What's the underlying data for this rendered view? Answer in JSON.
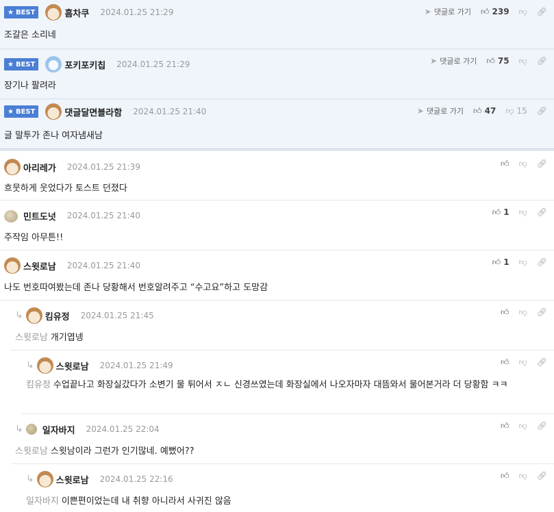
{
  "labels": {
    "best": "BEST",
    "goto": "댓글로 가기"
  },
  "comments": [
    {
      "best": true,
      "nick": "흠차쿠",
      "date": "2024.01.25 21:29",
      "text": "조갈은 소리네",
      "likes": "239"
    },
    {
      "best": true,
      "nick": "포키포키칩",
      "date": "2024.01.25 21:29",
      "text": "장기나 팔려라",
      "likes": "75"
    },
    {
      "best": true,
      "nick": "댓글달면블라함",
      "date": "2024.01.25 21:40",
      "text": "글 말투가 존나 여자냄새남",
      "likes": "47",
      "dislikes": "15"
    },
    {
      "nick": "아리레가",
      "date": "2024.01.25 21:39",
      "text": "흐뭇하게 웃었다가 토스트 던졌다"
    },
    {
      "nick": "민트도넛",
      "date": "2024.01.25 21:40",
      "text": "주작임 아무튼!!",
      "likes": "1"
    },
    {
      "nick": "스윗로남",
      "date": "2024.01.25 21:40",
      "text": "나도 번호따여봤는데 존나 당황해서 번호알려주고 “수고요”하고 도망감",
      "likes": "1"
    },
    {
      "nick": "킴유정",
      "date": "2024.01.25 21:45",
      "mention": "스윗로남",
      "text": "개기엽넹"
    },
    {
      "nick": "스윗로남",
      "date": "2024.01.25 21:49",
      "mention": "킴유정",
      "text": "수업끝나고 화장실갔다가 소변기 물 튀어서 ㅈㄴ 신경쓰였는데 화장실에서 나오자마자 대뜸와서 물어본거라 더 당황함 ㅋㅋ"
    },
    {
      "nick": "일자바지",
      "date": "2024.01.25 22:04",
      "mention": "스윗로남",
      "text": "스윗남이라 그런가 인기많네. 예뻤어??"
    },
    {
      "nick": "스윗로남",
      "date": "2024.01.25 22:16",
      "mention": "일자바지",
      "text": "이쁜편이었는데 내 취향 아니라서 사귀진 않음"
    }
  ]
}
